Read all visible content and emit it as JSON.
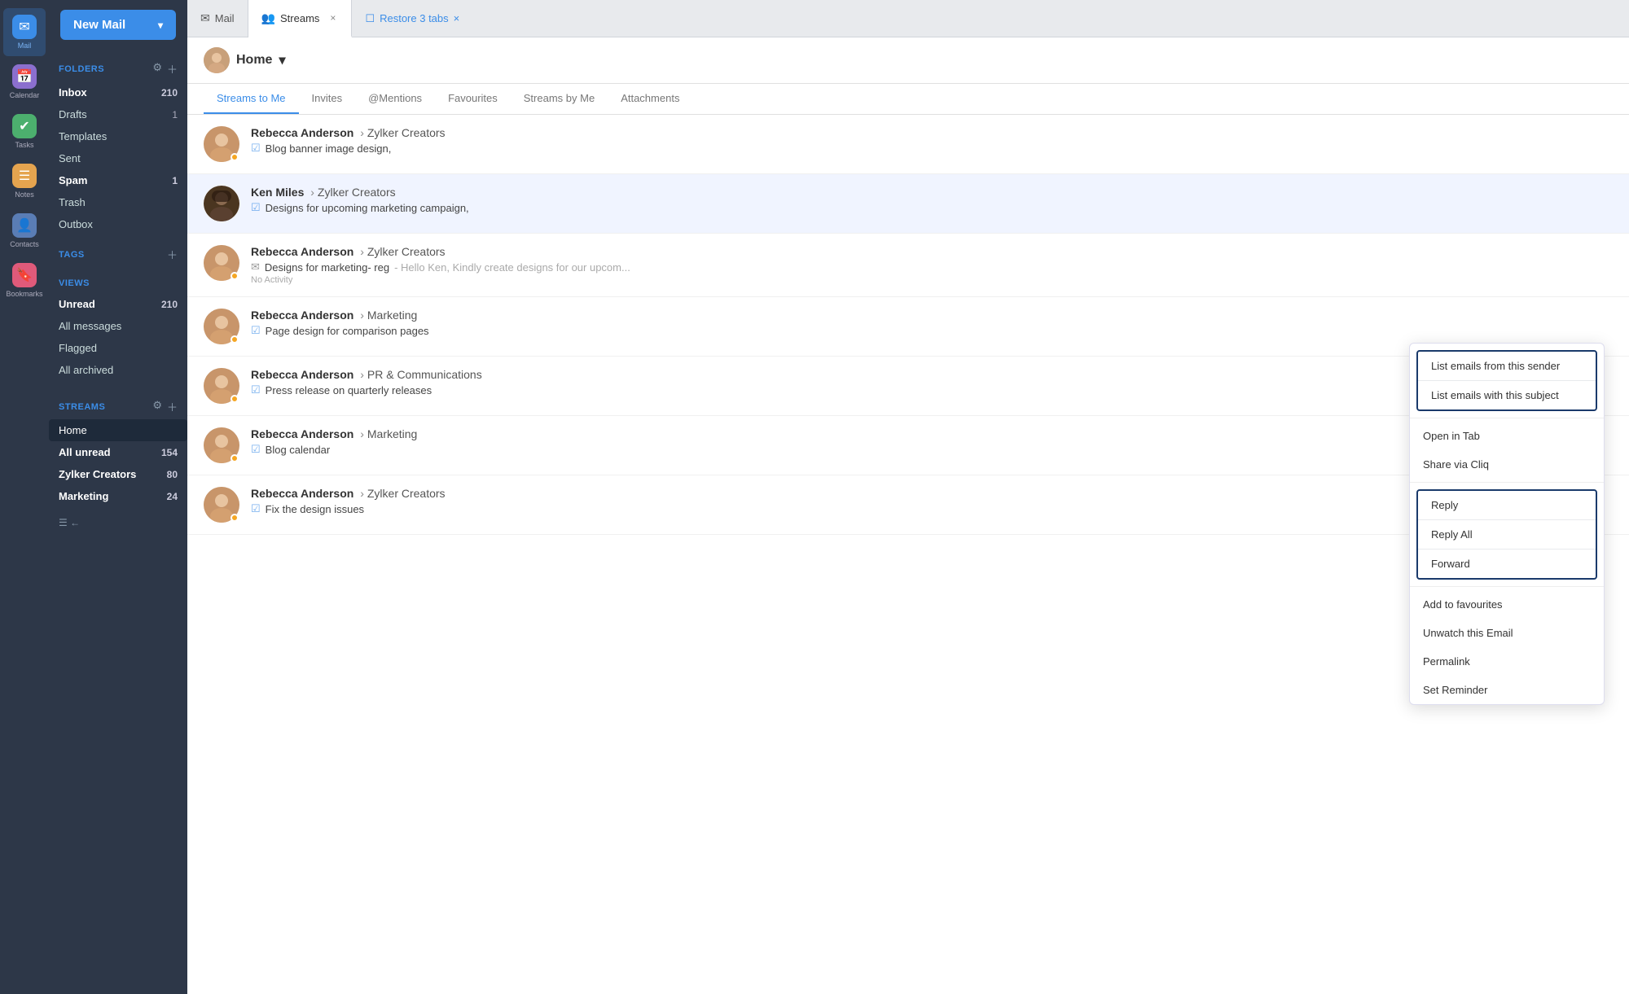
{
  "sidebar": {
    "new_mail_label": "New Mail",
    "sections": {
      "folders": {
        "title": "FOLDERS",
        "items": [
          {
            "name": "Inbox",
            "count": "210",
            "bold": true,
            "active": false
          },
          {
            "name": "Drafts",
            "count": "1",
            "bold": false,
            "active": false
          },
          {
            "name": "Templates",
            "count": "",
            "bold": false,
            "active": false
          },
          {
            "name": "Sent",
            "count": "",
            "bold": false,
            "active": false
          },
          {
            "name": "Spam",
            "count": "1",
            "bold": true,
            "active": false
          },
          {
            "name": "Trash",
            "count": "",
            "bold": false,
            "active": false
          },
          {
            "name": "Outbox",
            "count": "",
            "bold": false,
            "active": false
          }
        ]
      },
      "tags": {
        "title": "TAGS"
      },
      "views": {
        "title": "VIEWS",
        "items": [
          {
            "name": "Unread",
            "count": "210",
            "bold": true,
            "active": false
          },
          {
            "name": "All messages",
            "count": "",
            "bold": false,
            "active": false
          },
          {
            "name": "Flagged",
            "count": "",
            "bold": false,
            "active": false
          },
          {
            "name": "All archived",
            "count": "",
            "bold": false,
            "active": false
          }
        ]
      },
      "streams": {
        "title": "STREAMS",
        "items": [
          {
            "name": "Home",
            "count": "",
            "bold": false,
            "active": true
          },
          {
            "name": "All unread",
            "count": "154",
            "bold": true,
            "active": false
          },
          {
            "name": "Zylker Creators",
            "count": "80",
            "bold": true,
            "active": false
          },
          {
            "name": "Marketing",
            "count": "24",
            "bold": true,
            "active": false
          }
        ]
      }
    },
    "nav_icons": [
      {
        "id": "mail",
        "label": "Mail",
        "icon": "✉",
        "bg": "mail-icon-bg",
        "active": true
      },
      {
        "id": "calendar",
        "label": "Calendar",
        "icon": "📅",
        "bg": "calendar-icon-bg",
        "active": false
      },
      {
        "id": "tasks",
        "label": "Tasks",
        "icon": "✓",
        "bg": "tasks-icon-bg",
        "active": false
      },
      {
        "id": "notes",
        "label": "Notes",
        "icon": "≡",
        "bg": "notes-icon-bg",
        "active": false
      },
      {
        "id": "contacts",
        "label": "Contacts",
        "icon": "👤",
        "bg": "contacts-icon-bg",
        "active": false
      },
      {
        "id": "bookmarks",
        "label": "Bookmarks",
        "icon": "🔖",
        "bg": "bookmarks-icon-bg",
        "active": false
      }
    ]
  },
  "tabs": {
    "items": [
      {
        "id": "mail",
        "label": "Mail",
        "icon": "✉",
        "active": false,
        "closeable": false
      },
      {
        "id": "streams",
        "label": "Streams",
        "icon": "👥",
        "active": true,
        "closeable": true
      }
    ],
    "restore_label": "Restore 3 tabs",
    "restore_close": "×"
  },
  "header": {
    "home_label": "Home",
    "chevron": "▾"
  },
  "stream_tabs": {
    "items": [
      {
        "id": "streams-to-me",
        "label": "Streams to Me",
        "active": true
      },
      {
        "id": "invites",
        "label": "Invites",
        "active": false
      },
      {
        "id": "mentions",
        "label": "@Mentions",
        "active": false
      },
      {
        "id": "favourites",
        "label": "Favourites",
        "active": false
      },
      {
        "id": "streams-by-me",
        "label": "Streams by Me",
        "active": false
      },
      {
        "id": "attachments",
        "label": "Attachments",
        "active": false
      }
    ]
  },
  "emails": [
    {
      "id": 1,
      "sender": "Rebecca Anderson",
      "arrow": "›",
      "channel": "Zylker Creators",
      "subject_icon": "check",
      "subject": "Blog banner image design,",
      "has_dot": true,
      "highlighted": false
    },
    {
      "id": 2,
      "sender": "Ken Miles",
      "arrow": "›",
      "channel": "Zylker Creators",
      "subject_icon": "check",
      "subject": "Designs for upcoming marketing campaign,",
      "has_dot": false,
      "highlighted": true
    },
    {
      "id": 3,
      "sender": "Rebecca Anderson",
      "arrow": "›",
      "channel": "Zylker Creators",
      "subject_icon": "envelope",
      "subject": "Designs for marketing- reg",
      "preview": "Hello Ken, Kindly create designs for our upcom...",
      "no_activity": "No Activity",
      "has_dot": true,
      "highlighted": false
    },
    {
      "id": 4,
      "sender": "Rebecca Anderson",
      "arrow": "›",
      "channel": "Marketing",
      "subject_icon": "check",
      "subject": "Page design for comparison pages",
      "has_dot": true,
      "highlighted": false
    },
    {
      "id": 5,
      "sender": "Rebecca Anderson",
      "arrow": "›",
      "channel": "PR & Communications",
      "subject_icon": "check",
      "subject": "Press release on quarterly releases",
      "has_dot": true,
      "highlighted": false
    },
    {
      "id": 6,
      "sender": "Rebecca Anderson",
      "arrow": "›",
      "channel": "Marketing",
      "subject_icon": "check",
      "subject": "Blog calendar",
      "has_dot": true,
      "highlighted": false
    },
    {
      "id": 7,
      "sender": "Rebecca Anderson",
      "arrow": "›",
      "channel": "Zylker Creators",
      "subject_icon": "check",
      "subject": "Fix the design issues",
      "has_dot": true,
      "highlighted": false
    }
  ],
  "context_menu": {
    "section1": [
      {
        "id": "list-sender",
        "label": "List emails from this sender"
      },
      {
        "id": "list-subject",
        "label": "List emails with this subject"
      }
    ],
    "plain_items": [
      {
        "id": "open-tab",
        "label": "Open in Tab"
      },
      {
        "id": "share-cliq",
        "label": "Share via Cliq"
      }
    ],
    "section2": [
      {
        "id": "reply",
        "label": "Reply"
      },
      {
        "id": "reply-all",
        "label": "Reply All"
      },
      {
        "id": "forward",
        "label": "Forward"
      }
    ],
    "bottom_items": [
      {
        "id": "add-fav",
        "label": "Add to favourites"
      },
      {
        "id": "unwatch",
        "label": "Unwatch this Email"
      },
      {
        "id": "permalink",
        "label": "Permalink"
      },
      {
        "id": "reminder",
        "label": "Set Reminder"
      }
    ]
  }
}
